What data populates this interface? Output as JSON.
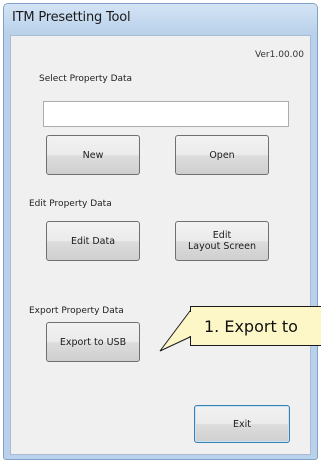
{
  "window": {
    "title": "ITM Presetting Tool"
  },
  "version": "Ver1.00.00",
  "select": {
    "label": "Select Property Data",
    "path_value": "",
    "new_label": "New",
    "open_label": "Open"
  },
  "edit": {
    "label": "Edit Property Data",
    "edit_data_label": "Edit Data",
    "edit_layout_label": "Edit\nLayout Screen"
  },
  "export": {
    "label": "Export Property Data",
    "usb_label": "Export to USB"
  },
  "exit_label": "Exit",
  "callout": {
    "text": "1. Export to"
  }
}
